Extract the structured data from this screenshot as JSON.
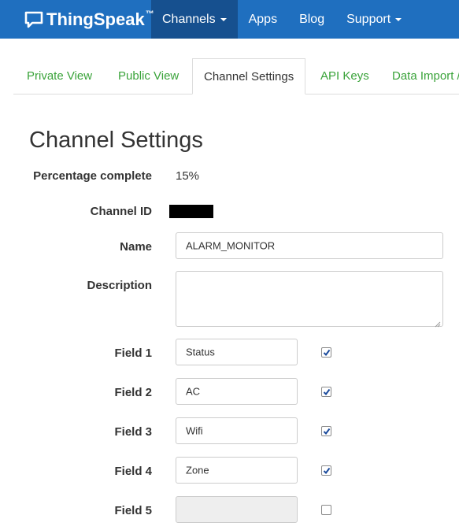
{
  "navbar": {
    "brand": "ThingSpeak",
    "brand_tm": "™",
    "items": [
      {
        "label": "Channels",
        "dropdown": true,
        "active": true
      },
      {
        "label": "Apps",
        "dropdown": false,
        "active": false
      },
      {
        "label": "Blog",
        "dropdown": false,
        "active": false
      },
      {
        "label": "Support",
        "dropdown": true,
        "active": false
      }
    ]
  },
  "tabs": [
    {
      "label": "Private View",
      "active": false
    },
    {
      "label": "Public View",
      "active": false
    },
    {
      "label": "Channel Settings",
      "active": true
    },
    {
      "label": "API Keys",
      "active": false
    },
    {
      "label": "Data Import /",
      "active": false
    }
  ],
  "page": {
    "title": "Channel Settings"
  },
  "form": {
    "percentage_label": "Percentage complete",
    "percentage_value": "15%",
    "channel_id_label": "Channel ID",
    "name_label": "Name",
    "name_value": "ALARM_MONITOR",
    "description_label": "Description",
    "description_value": "",
    "fields": [
      {
        "label": "Field 1",
        "value": "Status",
        "checked": true,
        "enabled": true
      },
      {
        "label": "Field 2",
        "value": "AC",
        "checked": true,
        "enabled": true
      },
      {
        "label": "Field 3",
        "value": "Wifi",
        "checked": true,
        "enabled": true
      },
      {
        "label": "Field 4",
        "value": "Zone",
        "checked": true,
        "enabled": true
      },
      {
        "label": "Field 5",
        "value": "",
        "checked": false,
        "enabled": false
      }
    ]
  },
  "colors": {
    "navbar": "#1f6fbf",
    "navbar_active": "#16508f",
    "tab_link": "#3aa33a",
    "checkbox_check": "#1a4a9c"
  }
}
